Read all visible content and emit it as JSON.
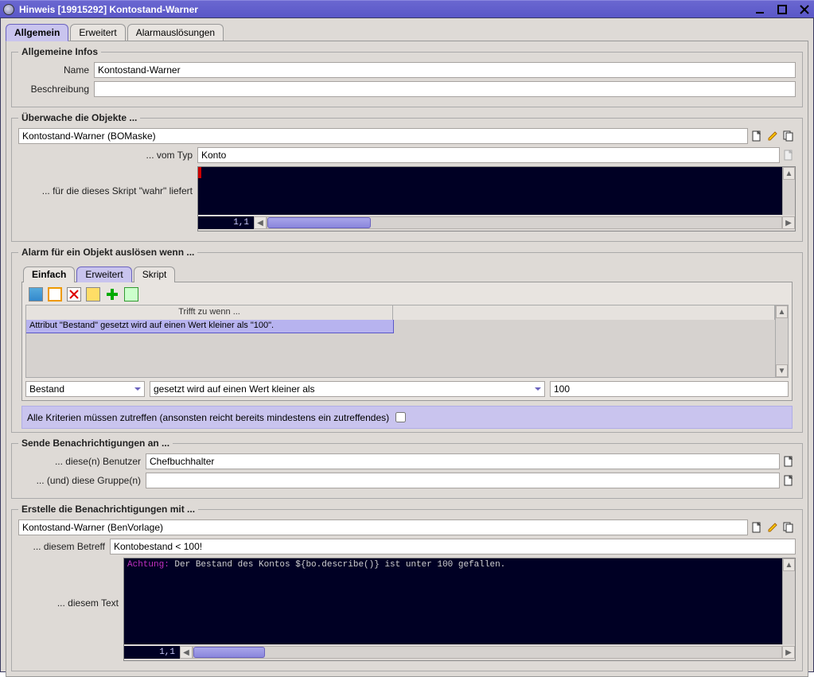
{
  "window": {
    "title": "Hinweis [19915292] Kontostand-Warner"
  },
  "tabs": {
    "main": [
      "Allgemein",
      "Erweitert",
      "Alarmauslösungen"
    ],
    "activeIndex": 0
  },
  "section_general": {
    "legend": "Allgemeine Infos",
    "name_label": "Name",
    "name_value": "Kontostand-Warner",
    "desc_label": "Beschreibung",
    "desc_value": ""
  },
  "section_monitor": {
    "legend": "Überwache die Objekte ...",
    "object_value": "Kontostand-Warner (BOMaske)",
    "type_label": "... vom Typ",
    "type_value": "Konto",
    "script_label": "... für die dieses Skript \"wahr\" liefert",
    "linecol": "1,1"
  },
  "section_alarm": {
    "legend": "Alarm für ein Objekt auslösen wenn ...",
    "inner_tabs": [
      "Einfach",
      "Erweitert",
      "Skript"
    ],
    "inner_active": 1,
    "table_header": "Trifft zu wenn ...",
    "table_row": "Attribut \"Bestand\" gesetzt wird auf einen Wert kleiner als \"100\".",
    "combo_attr": "Bestand",
    "combo_op": "gesetzt wird auf einen Wert kleiner als",
    "value_input": "100",
    "criteria_note": "Alle Kriterien müssen zutreffen (ansonsten reicht bereits mindestens ein zutreffendes)"
  },
  "section_notify": {
    "legend": "Sende Benachrichtigungen an ...",
    "user_label": "... diese(n) Benutzer",
    "user_value": "Chefbuchhalter",
    "group_label": "... (und) diese Gruppe(n)",
    "group_value": ""
  },
  "section_template": {
    "legend": "Erstelle die Benachrichtigungen mit ...",
    "template_value": "Kontostand-Warner (BenVorlage)",
    "subject_label": "... diesem Betreff",
    "subject_value": "Kontobestand < 100!",
    "text_label": "... diesem Text",
    "keyword": "Achtung:",
    "body_text": " Der Bestand des Kontos ${bo.describe()} ist unter 100 gefallen.",
    "linecol": "1,1"
  },
  "icons": {
    "doc": "doc-icon",
    "pencil": "pencil-icon",
    "copy": "copy-icon"
  },
  "toolbar_icons": [
    "grid-icon",
    "calendar-icon",
    "x-icon",
    "print-icon",
    "plus-icon",
    "sheet-icon"
  ]
}
